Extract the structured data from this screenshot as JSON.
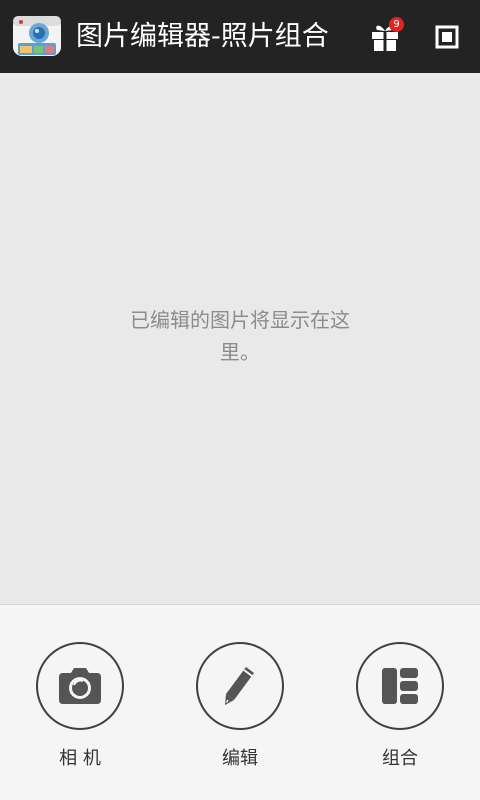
{
  "app": {
    "title": "图片编辑器-照片组合",
    "notification_count": "9"
  },
  "icons": {
    "app": "photo-app-icon",
    "gift": "gift-icon",
    "window": "window-icon",
    "camera": "camera-icon",
    "edit": "pencil-icon",
    "collage": "grid-icon"
  },
  "content": {
    "empty_message": "已编辑的图片将显示在这里。"
  },
  "actions": {
    "camera_label": "相 机",
    "edit_label": "编辑",
    "collage_label": "组合"
  },
  "colors": {
    "topbar": "#232323",
    "content_bg": "#e9e9e9",
    "bottombar_bg": "#f5f5f5",
    "badge": "#e02424",
    "icon": "#555555"
  }
}
